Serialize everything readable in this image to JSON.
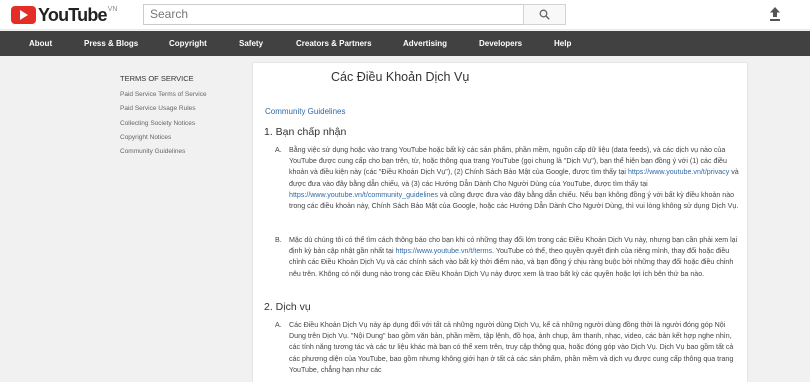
{
  "header": {
    "logo_text": "YouTube",
    "logo_region": "VN",
    "search_placeholder": "Search"
  },
  "nav": {
    "items": [
      "About",
      "Press & Blogs",
      "Copyright",
      "Safety",
      "Creators & Partners",
      "Advertising",
      "Developers",
      "Help"
    ]
  },
  "sidebar": {
    "heading": "TERMS OF SERVICE",
    "links": [
      "Paid Service Terms of Service",
      "Paid Service Usage Rules",
      "Collecting Society Notices",
      "Copyright Notices",
      "Community Guidelines"
    ]
  },
  "main": {
    "title": "Các Điều Khoản Dịch Vụ",
    "top_link": "Community Guidelines",
    "section1": {
      "title": "1. Bạn chấp nhận",
      "a_mark": "A.",
      "a_t1": "Bằng việc sử dụng hoặc vào trang YouTube hoặc bất kỳ các sản phẩm, phần mềm, nguồn cấp dữ liệu (data feeds), và các dịch vụ nào của YouTube được cung cấp cho bạn trên, từ, hoặc thông qua trang YouTube (gọi chung là \"Dịch Vụ\"), bạn thể hiện bạn đồng ý với (1) các điều khoản và điều kiện này (các \"Điều Khoản Dịch Vụ\"), (2) Chính Sách Bảo Mật của Google, được tìm thấy tại ",
      "a_l1": "https://www.youtube.vn/t/privacy",
      "a_t2": " và được đưa vào đây bằng dẫn chiếu, và (3) các Hướng Dẫn Dành Cho Người Dùng của YouTube, được tìm thấy tại ",
      "a_l2": "https://www.youtube.vn/t/community_guidelines",
      "a_t3": " và cũng được đưa vào đây bằng dẫn chiếu. Nếu bạn không đồng ý với bất kỳ điều khoản nào trong các điều khoản này, Chính Sách Bảo Mật của Google, hoặc các Hướng Dẫn Dành Cho Người Dùng, thì vui lòng không sử dụng Dịch Vụ.",
      "b_mark": "B.",
      "b_t1": "Mặc dù chúng tôi có thể tìm cách thông báo cho bạn khi có những thay đổi lớn trong các Điều Khoản Dịch Vụ này, nhưng bạn cần phải xem lại định kỳ bản cập nhật gần nhất tại ",
      "b_l1": "https://www.youtube.vn/t/terms",
      "b_t2": ". YouTube có thể, theo quyền quyết định của riêng mình, thay đổi hoặc điều chỉnh các Điều Khoản Dịch Vụ và các chính sách vào bất kỳ thời điểm nào, và bạn đồng ý chịu ràng buộc bởi những thay đổi hoặc điều chỉnh nêu trên. Không có nội dung nào trong các Điều Khoản Dịch Vụ này được xem là trao bất kỳ các quyền hoặc lợi ích bên thứ ba nào."
    },
    "section2": {
      "title": "2. Dịch vụ",
      "a_mark": "A.",
      "a_t1": "Các Điều Khoản Dịch Vụ này áp dụng đối với tất cả những người dùng Dịch Vụ, kể cả những người dùng đồng thời là người đóng góp Nội Dung trên Dịch Vụ. \"Nội Dung\" bao gồm văn bản, phần mềm, tập lệnh, đồ họa, ảnh chụp, âm thanh, nhạc, video, các bản kết hợp nghe nhìn, các tính năng tương tác và các tư liệu khác mà bạn có thể xem trên, truy cập thông qua, hoặc đóng góp vào Dịch Vụ. Dịch Vụ bao gồm tất cả các phương diện của YouTube, bao gồm nhưng không giới hạn ở tất cả các sản phẩm, phần mềm và dịch vụ được cung cấp thông qua trang YouTube, chẳng hạn như các"
    }
  }
}
